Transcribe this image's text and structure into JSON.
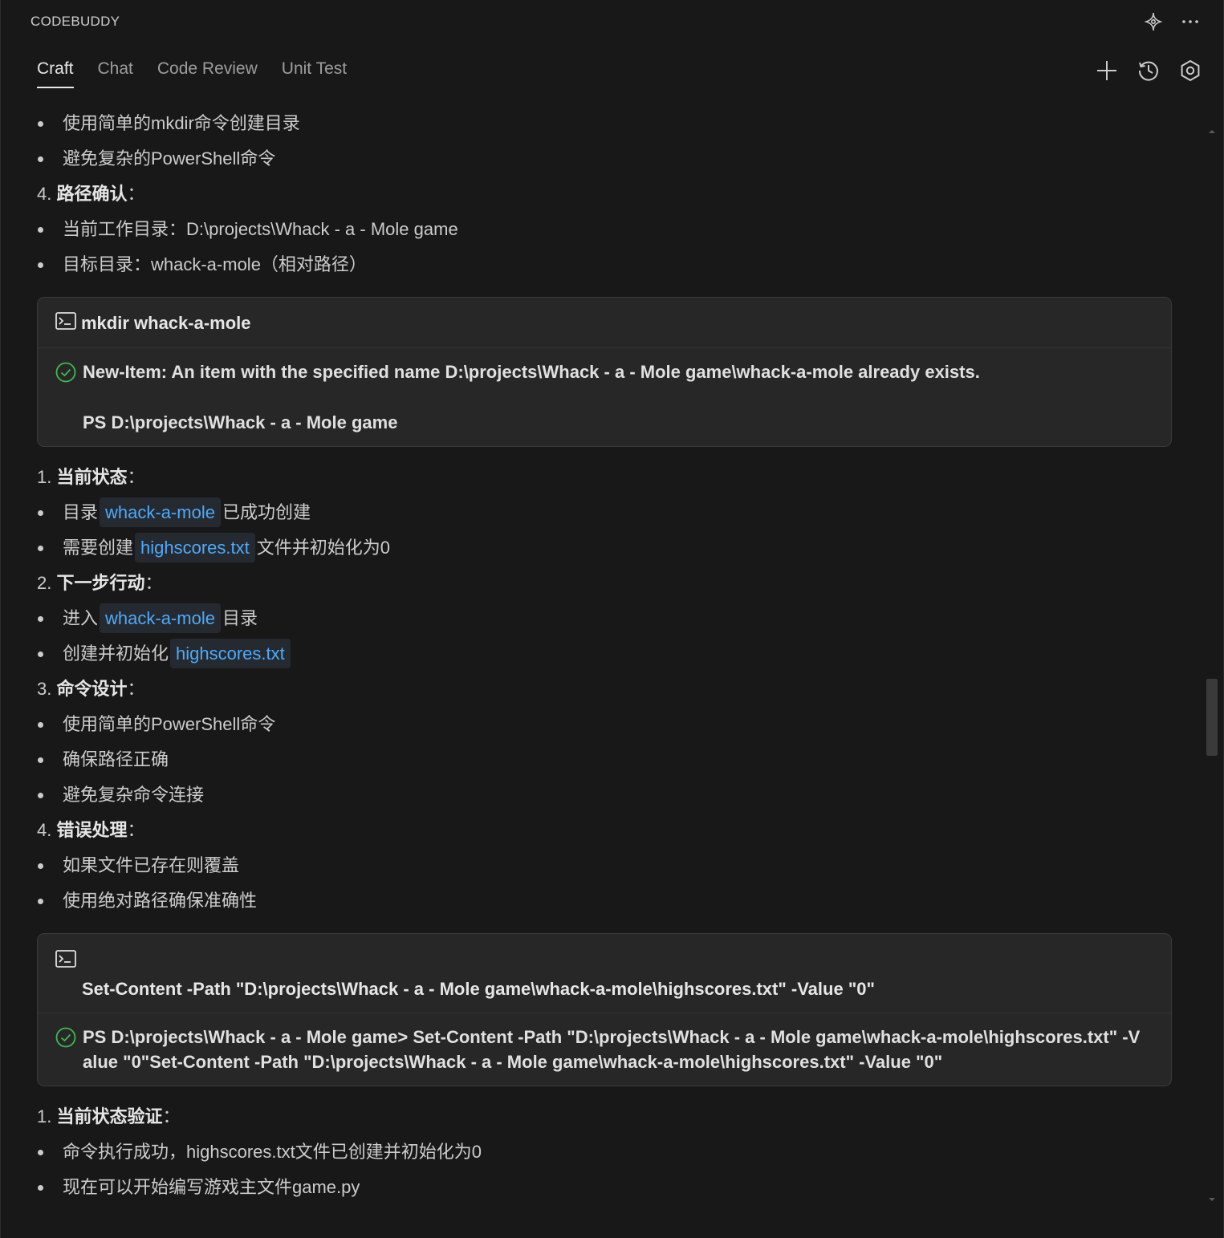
{
  "header": {
    "title": "CODEBUDDY",
    "icons": [
      "sparkle-icon",
      "more-icon"
    ]
  },
  "tabs": [
    {
      "label": "Craft",
      "active": true
    },
    {
      "label": "Chat",
      "active": false
    },
    {
      "label": "Code Review",
      "active": false
    },
    {
      "label": "Unit Test",
      "active": false
    }
  ],
  "actions": [
    "add-icon",
    "history-icon",
    "settings-icon"
  ],
  "section1": {
    "b1": "使用简单的mkdir命令创建目录",
    "b2": "避免复杂的PowerShell命令",
    "h4_num": "4. ",
    "h4_title": "路径确认",
    "h4_colon": "：",
    "b3_prefix": "当前工作目录：",
    "b3_value": "D:\\projects\\Whack - a - Mole game",
    "b4": "目标目录：whack-a-mole（相对路径）"
  },
  "terminal1": {
    "command": "mkdir whack-a-mole",
    "output_line1": "New-Item: An item with the specified name D:\\projects\\Whack - a - Mole game\\whack-a-mole already exists.",
    "output_line2": "PS D:\\projects\\Whack - a - Mole game"
  },
  "section2": {
    "h1_num": "1. ",
    "h1_title": "当前状态",
    "h1_colon": "：",
    "b1_pre": "目录",
    "b1_code": "whack-a-mole",
    "b1_post": "已成功创建",
    "b2_pre": "需要创建",
    "b2_code": "highscores.txt",
    "b2_post": "文件并初始化为0",
    "h2_num": "2. ",
    "h2_title": "下一步行动",
    "h2_colon": "：",
    "b3_pre": "进入",
    "b3_code": "whack-a-mole",
    "b3_post": "目录",
    "b4_pre": "创建并初始化",
    "b4_code": "highscores.txt",
    "h3_num": "3. ",
    "h3_title": "命令设计",
    "h3_colon": "：",
    "b5": "使用简单的PowerShell命令",
    "b6": "确保路径正确",
    "b7": "避免复杂命令连接",
    "h4_num": "4. ",
    "h4_title": "错误处理",
    "h4_colon": "：",
    "b8": "如果文件已存在则覆盖",
    "b9": "使用绝对路径确保准确性"
  },
  "terminal2": {
    "command": "Set-Content -Path \"D:\\projects\\Whack - a - Mole game\\whack-a-mole\\highscores.txt\" -Value \"0\"",
    "output_line1": "PS D:\\projects\\Whack - a - Mole game> Set-Content -Path \"D:\\projects\\Whack - a - Mole game\\whack-a-mole\\highscores.txt\" -V",
    "output_line2": "alue \"0\"Set-Content -Path \"D:\\projects\\Whack - a - Mole game\\whack-a-mole\\highscores.txt\" -Value \"0\""
  },
  "section3": {
    "h1_num": "1. ",
    "h1_title": "当前状态验证",
    "h1_colon": "：",
    "b1": "命令执行成功，highscores.txt文件已创建并初始化为0",
    "b2": "现在可以开始编写游戏主文件game.py"
  },
  "colors": {
    "background": "#181818",
    "code_link": "#4daafc",
    "success": "#3fb950"
  }
}
